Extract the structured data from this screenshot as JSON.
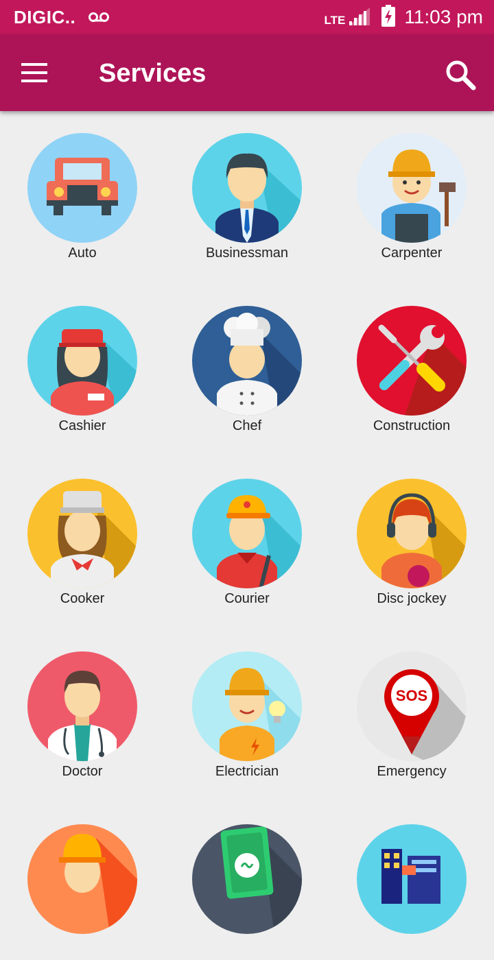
{
  "status": {
    "carrier": "DIGIC..",
    "network": "LTE",
    "time": "11:03 pm"
  },
  "appbar": {
    "title": "Services"
  },
  "services": [
    {
      "label": "Auto",
      "icon": "car-icon",
      "color": "#8fd3f7"
    },
    {
      "label": "Businessman",
      "icon": "businessman-icon",
      "color": "#5dd3e9"
    },
    {
      "label": "Carpenter",
      "icon": "carpenter-icon",
      "color": "#e3eef8"
    },
    {
      "label": "Cashier",
      "icon": "cashier-icon",
      "color": "#5dd3e9"
    },
    {
      "label": "Chef",
      "icon": "chef-icon",
      "color": "#2f5f96"
    },
    {
      "label": "Construction",
      "icon": "tools-icon",
      "color": "#e0102e"
    },
    {
      "label": "Cooker",
      "icon": "cook-icon",
      "color": "#fbc02d"
    },
    {
      "label": "Courier",
      "icon": "courier-icon",
      "color": "#5dd3e9"
    },
    {
      "label": "Disc jockey",
      "icon": "dj-icon",
      "color": "#fbc02d"
    },
    {
      "label": "Doctor",
      "icon": "doctor-icon",
      "color": "#ef5a6a"
    },
    {
      "label": "Electrician",
      "icon": "electrician-icon",
      "color": "#b3ecf5"
    },
    {
      "label": "Emergency",
      "icon": "sos-pin-icon",
      "color": "#e8e8e8"
    },
    {
      "label": "",
      "icon": "worker-icon",
      "color": "#ff8a50"
    },
    {
      "label": "",
      "icon": "money-icon",
      "color": "#4a5568"
    },
    {
      "label": "",
      "icon": "buildings-icon",
      "color": "#5dd3e9"
    }
  ],
  "sos_text": "SOS"
}
